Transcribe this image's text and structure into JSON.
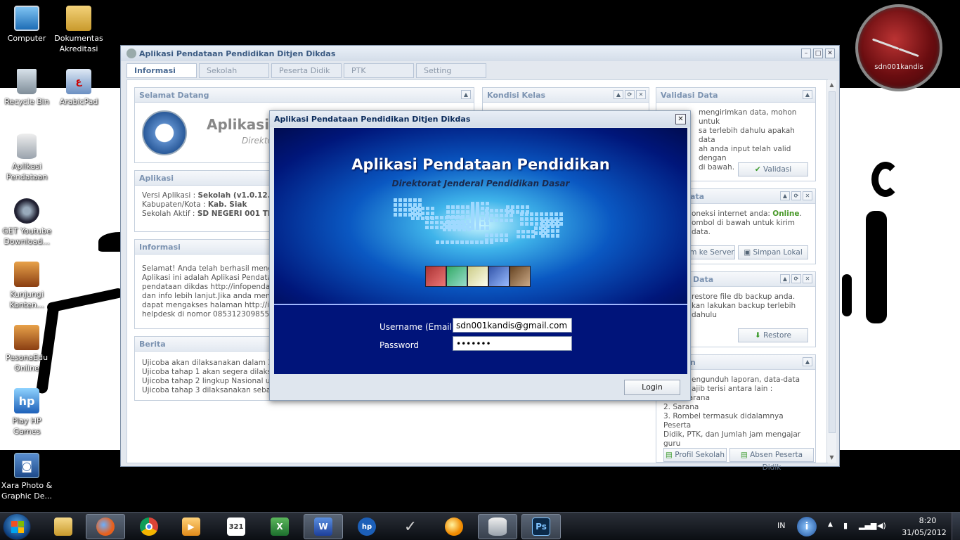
{
  "desktop": {
    "icons": [
      {
        "label": "Computer",
        "icon": "computer-icon"
      },
      {
        "label": "Dokumentas Akreditasi",
        "icon": "folder-icon"
      },
      {
        "label": "Recycle Bin",
        "icon": "recycle-bin-icon"
      },
      {
        "label": "ArabicPad",
        "icon": "arabicpad-icon"
      },
      {
        "label": "Aplikasi Pendataan",
        "icon": "database-icon"
      },
      {
        "label": "GET Youtube Download...",
        "icon": "film-reel-icon"
      },
      {
        "label": "Kunjungi Konten...",
        "icon": "box-icon"
      },
      {
        "label": "PesonaEdu Online",
        "icon": "box-icon"
      },
      {
        "label": "Play HP Games",
        "icon": "hp-games-icon"
      },
      {
        "label": "Xara Photo & Graphic De...",
        "icon": "camera-icon"
      }
    ],
    "clock_label": "sdn001kandis"
  },
  "main_window": {
    "title": "Aplikasi Pendataan Pendidikan Ditjen Dikdas",
    "tabs": [
      "Informasi",
      "Sekolah",
      "Peserta Didik",
      "PTK",
      "Setting"
    ],
    "panels": {
      "welcome": {
        "title": "Selamat Datang",
        "logo_text": "Aplikasi P",
        "logo_sub": "Direkto"
      },
      "aplikasi": {
        "title": "Aplikasi",
        "versi_label": "Versi Aplikasi : ",
        "versi_value": "Sekolah (v1.0.12.05",
        "kab_label": "Kabupaten/Kota : ",
        "kab_value": "Kab. Siak",
        "sekolah_label": "Sekolah Aktif : ",
        "sekolah_value": "SD NEGERI 001 TELA"
      },
      "informasi": {
        "title": "Informasi",
        "lines": [
          "Selamat! Anda telah berhasil menginst",
          "Aplikasi ini adalah Aplikasi Pendataan P",
          "pendataan dikdas http://infopendataa",
          "dan info lebih lanjut.Jika anda menemu",
          "dapat mengakses halaman http://infop",
          "helpdesk di nomor 085312309855atau"
        ]
      },
      "berita": {
        "title": "Berita",
        "lines": [
          "Ujicoba akan dilaksanakan dalam 3 tah",
          "Ujicoba tahap 1 akan segera dilaksana",
          "Ujicoba tahap 2 lingkup Nasional untuk",
          "Ujicoba tahap 3 dilaksanakan sebagai"
        ]
      },
      "kondisi_kelas": {
        "title": "Kondisi Kelas"
      },
      "validasi": {
        "title": "Validasi Data",
        "lines": [
          "mengirimkan data, mohon untuk",
          "sa terlebih dahulu apakah data",
          "ah anda input telah valid dengan",
          "di bawah."
        ],
        "button": "Validasi"
      },
      "kirim": {
        "title": "ata",
        "line1_prefix": "oneksi internet anda: ",
        "line1_status": "Online",
        "line2": "ombol di bawah untuk kirim data.",
        "button_server": "m ke Server",
        "button_lokal": "Simpan Lokal"
      },
      "restore": {
        "title": "Data",
        "lines": [
          "restore file db backup anda.",
          "kan lakukan backup terlebih dahulu"
        ],
        "button": "Restore"
      },
      "laporan": {
        "title": "n",
        "lines": [
          "engunduh laporan, data-data",
          "ajib terisi antara lain :",
          "1. Prasarana",
          "2. Sarana",
          "3. Rombel termasuk didalamnya Peserta",
          "Didik, PTK, dan Jumlah jam mengajar guru"
        ],
        "button_profil": "Profil Sekolah",
        "button_absen": "Absen Peserta Didik"
      }
    }
  },
  "dialog": {
    "title": "Aplikasi Pendataan Pendidikan Ditjen Dikdas",
    "banner_title": "Aplikasi Pendataan Pendidikan",
    "banner_subtitle": "Direktorat Jenderal Pendidikan Dasar",
    "username_label": "Username (Email)",
    "username_value": "sdn001kandis@gmail.com",
    "password_label": "Password",
    "password_value": "•••••••",
    "login_button": "Login"
  },
  "taskbar": {
    "apps": [
      "explorer-icon",
      "firefox-icon",
      "chrome-icon",
      "media-player-icon",
      "calendar-icon",
      "excel-icon",
      "word-icon",
      "hp-icon",
      "check-icon",
      "messenger-icon",
      "database-app-icon",
      "photoshop-icon"
    ],
    "calendar_text": "321",
    "photoshop_text": "Ps",
    "language": "IN",
    "time": "8:20",
    "date": "31/05/2012"
  },
  "colors": {
    "accent": "#3a5a82",
    "online": "#4a9a2a",
    "dialog_blue": "#00147a"
  }
}
